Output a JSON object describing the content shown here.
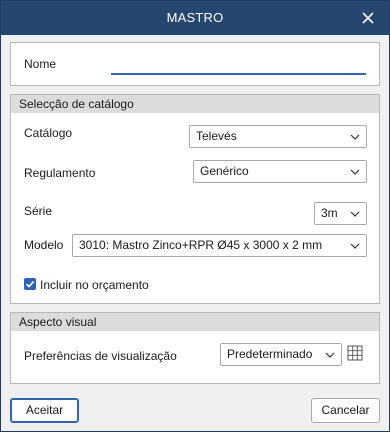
{
  "window": {
    "title": "MASTRO"
  },
  "name_section": {
    "label": "Nome",
    "value": ""
  },
  "catalog_section": {
    "header": "Selecção de catálogo",
    "catalog_label": "Catálogo",
    "catalog_value": "Televés",
    "regulation_label": "Regulamento",
    "regulation_value": "Genérico",
    "series_label": "Série",
    "series_value": "3m",
    "model_label": "Modelo",
    "model_value": "3010: Mastro Zinco+RPR Ø45 x 3000 x 2 mm",
    "include_budget_label": "Incluir no orçamento",
    "include_budget_checked": true
  },
  "visual_section": {
    "header": "Aspecto visual",
    "preferences_label": "Preferências de visualização",
    "preferences_value": "Predeterminado"
  },
  "footer": {
    "accept_label": "Aceitar",
    "cancel_label": "Cancelar"
  },
  "colors": {
    "titlebar": "#24466f",
    "accent": "#2c63b5"
  },
  "icons": {
    "close": "close-icon",
    "chevron": "chevron-down-icon",
    "check": "checkmark-icon",
    "grid": "grid-icon"
  }
}
